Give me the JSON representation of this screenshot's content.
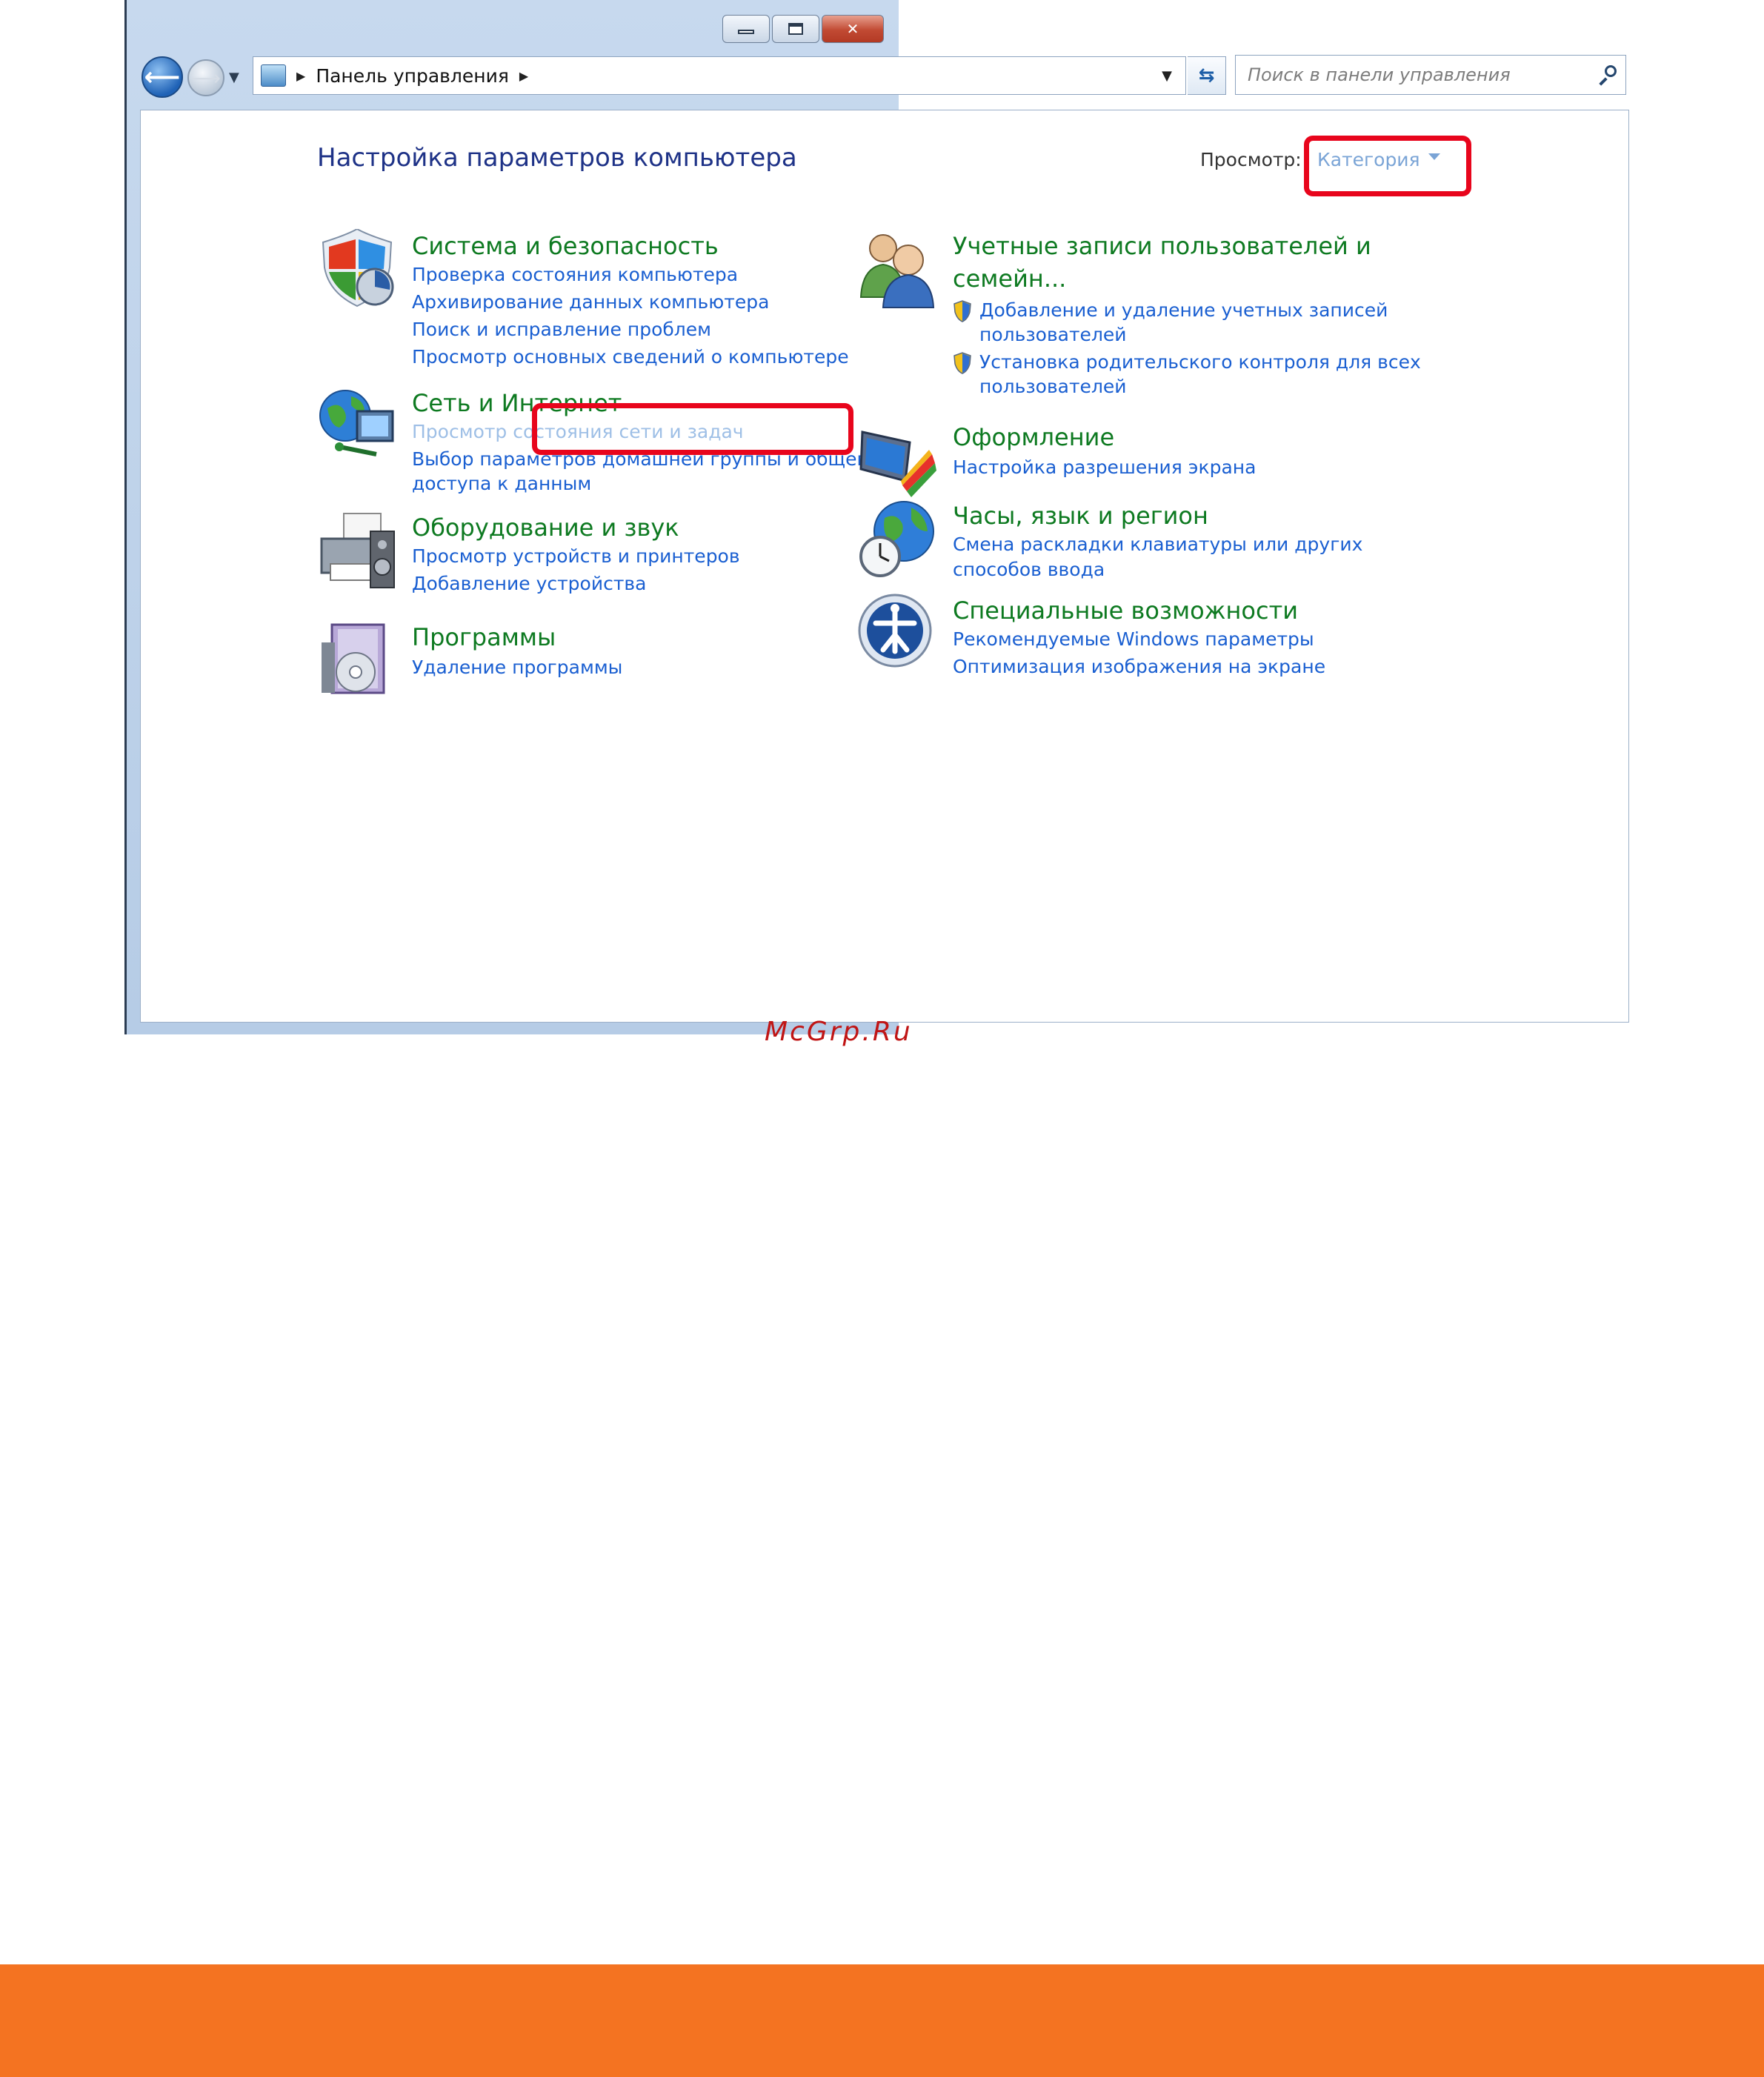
{
  "window": {
    "controls": {
      "minimize": "minimize",
      "maximize": "maximize",
      "close": "close"
    }
  },
  "address_bar": {
    "breadcrumb": [
      "Панель управления"
    ],
    "search_placeholder": "Поиск в панели управления"
  },
  "header": {
    "title": "Настройка параметров компьютера",
    "view_label": "Просмотр:",
    "view_value": "Категория"
  },
  "categories_left": [
    {
      "title": "Система и безопасность",
      "links": [
        "Проверка состояния компьютера",
        "Архивирование данных компьютера",
        "Поиск и исправление проблем",
        "Просмотр основных сведений о компьютере"
      ]
    },
    {
      "title": "Сеть и Интернет",
      "links": [
        "Просмотр состояния сети и задач",
        "Выбор параметров домашней группы и общего",
        "доступа к данным"
      ]
    },
    {
      "title": "Оборудование и звук",
      "links": [
        "Просмотр устройств и принтеров",
        "Добавление устройства"
      ]
    },
    {
      "title": "Программы",
      "links": [
        "Удаление программы"
      ]
    }
  ],
  "categories_right": [
    {
      "title_lines": [
        "Учетные записи пользователей и",
        "семейн..."
      ],
      "links": [
        {
          "lines": [
            "Добавление и удаление учетных записей",
            "пользователей"
          ]
        },
        {
          "lines": [
            "Установка родительского контроля для всех",
            "пользователей"
          ]
        }
      ]
    },
    {
      "title": "Оформление",
      "links": [
        "Настройка разрешения экрана"
      ]
    },
    {
      "title": "Часы, язык и регион",
      "links": [
        "Смена раскладки клавиатуры или других",
        "способов ввода"
      ]
    },
    {
      "title": "Специальные возможности",
      "links": [
        "Рекомендуемые Windows параметры",
        "Оптимизация изображения на экране"
      ]
    }
  ],
  "watermark": "McGrp.Ru",
  "colors": {
    "accent_title": "#0e7a21",
    "link": "#1a5fd1",
    "highlight": "#e8051c",
    "footer": "#f47321"
  }
}
